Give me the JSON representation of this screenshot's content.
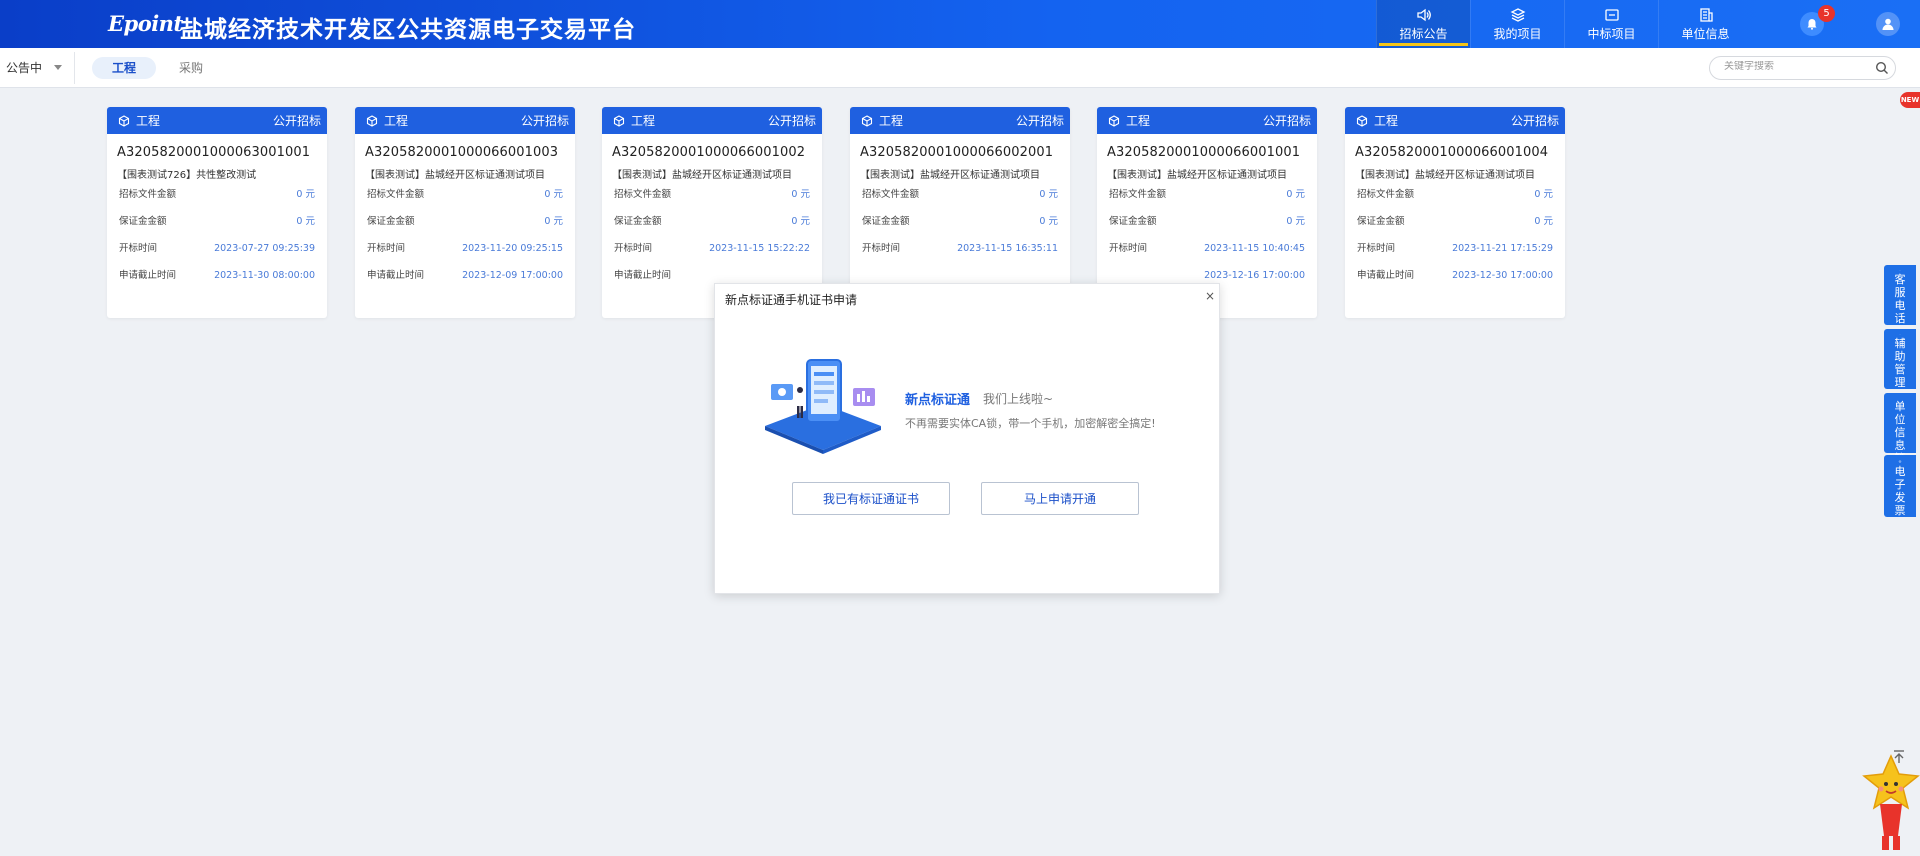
{
  "header": {
    "logo": "Epoint",
    "title": "盐城经济技术开发区公共资源电子交易平台",
    "nav": [
      {
        "label": "招标公告",
        "icon": "speaker-icon",
        "active": true
      },
      {
        "label": "我的项目",
        "icon": "layers-icon",
        "active": false
      },
      {
        "label": "中标项目",
        "icon": "folder-icon",
        "active": false
      },
      {
        "label": "单位信息",
        "icon": "building-icon",
        "active": false
      }
    ],
    "notification_count": "5"
  },
  "subbar": {
    "status_value": "公告中",
    "tabs": [
      {
        "label": "工程",
        "active": true
      },
      {
        "label": "采购",
        "active": false
      }
    ],
    "search_placeholder": "关键字搜索"
  },
  "cards": [
    {
      "category": "工程",
      "procurement_type": "公开招标",
      "code": "A320582000100006300​1001",
      "name": "【围表测试726】共性整改测试",
      "rows": [
        [
          "招标文件金额",
          "0 元"
        ],
        [
          "保证金金额",
          "0 元"
        ],
        [
          "开标时间",
          "2023-07-27 09:25:39"
        ],
        [
          "申请截止时间",
          "2023-11-30 08:00:00"
        ]
      ]
    },
    {
      "category": "工程",
      "procurement_type": "公开招标",
      "code": "A3205820001000066001003",
      "name": "【围表测试】盐城经开区标证通测试项目",
      "rows": [
        [
          "招标文件金额",
          "0 元"
        ],
        [
          "保证金金额",
          "0 元"
        ],
        [
          "开标时间",
          "2023-11-20 09:25:15"
        ],
        [
          "申请截止时间",
          "2023-12-09 17:00:00"
        ]
      ]
    },
    {
      "category": "工程",
      "procurement_type": "公开招标",
      "code": "A3205820001000066001002",
      "name": "【围表测试】盐城经开区标证通测试项目",
      "rows": [
        [
          "招标文件金额",
          "0 元"
        ],
        [
          "保证金金额",
          "0 元"
        ],
        [
          "开标时间",
          "2023-11-15 15:22:22"
        ],
        [
          "申请截止时间",
          ""
        ]
      ]
    },
    {
      "category": "工程",
      "procurement_type": "公开招标",
      "code": "A3205820001000066002001",
      "name": "【围表测试】盐城经开区标证通测试项目",
      "rows": [
        [
          "招标文件金额",
          "0 元"
        ],
        [
          "保证金金额",
          "0 元"
        ],
        [
          "开标时间",
          "2023-11-15 16:35:11"
        ],
        [
          "",
          ""
        ]
      ]
    },
    {
      "category": "工程",
      "procurement_type": "公开招标",
      "code": "A3205820001000066001001",
      "name": "【围表测试】盐城经开区标证通测试项目",
      "rows": [
        [
          "招标文件金额",
          "0 元"
        ],
        [
          "保证金金额",
          "0 元"
        ],
        [
          "开标时间",
          "2023-11-15 10:40:45"
        ],
        [
          "",
          "2023-12-16 17:00:00"
        ]
      ]
    },
    {
      "category": "工程",
      "procurement_type": "公开招标",
      "code": "A3205820001000066001004",
      "name": "【围表测试】盐城经开区标证通测试项目",
      "rows": [
        [
          "招标文件金额",
          "0 元"
        ],
        [
          "保证金金额",
          "0 元"
        ],
        [
          "开标时间",
          "2023-11-21 17:15:29"
        ],
        [
          "申请截止时间",
          "2023-12-30 17:00:00"
        ]
      ]
    }
  ],
  "dialog": {
    "title": "新点标证通手机证书申请",
    "close": "×",
    "brand": "新点标证通",
    "tagline": "我们上线啦~",
    "description": "不再需要实体CA锁，带一个手机，加密解密全搞定!",
    "btn_have_cert": "我已有标证通证书",
    "btn_apply": "马上申请开通"
  },
  "side_tools": [
    {
      "label": "客服电话",
      "icon": "headset-icon"
    },
    {
      "label": "辅助管理",
      "icon": "wrench-icon"
    },
    {
      "label": "单位信息管理",
      "icon": "gear-icon"
    },
    {
      "label": "电子发票",
      "icon": "invoice-icon"
    }
  ],
  "new_tag": "NEW",
  "colors": {
    "primary": "#1f60e0",
    "header_start": "#0a3ec8",
    "accent_underline": "#f5c518",
    "badge": "#e8332b",
    "value_text": "#4a7bd8"
  }
}
